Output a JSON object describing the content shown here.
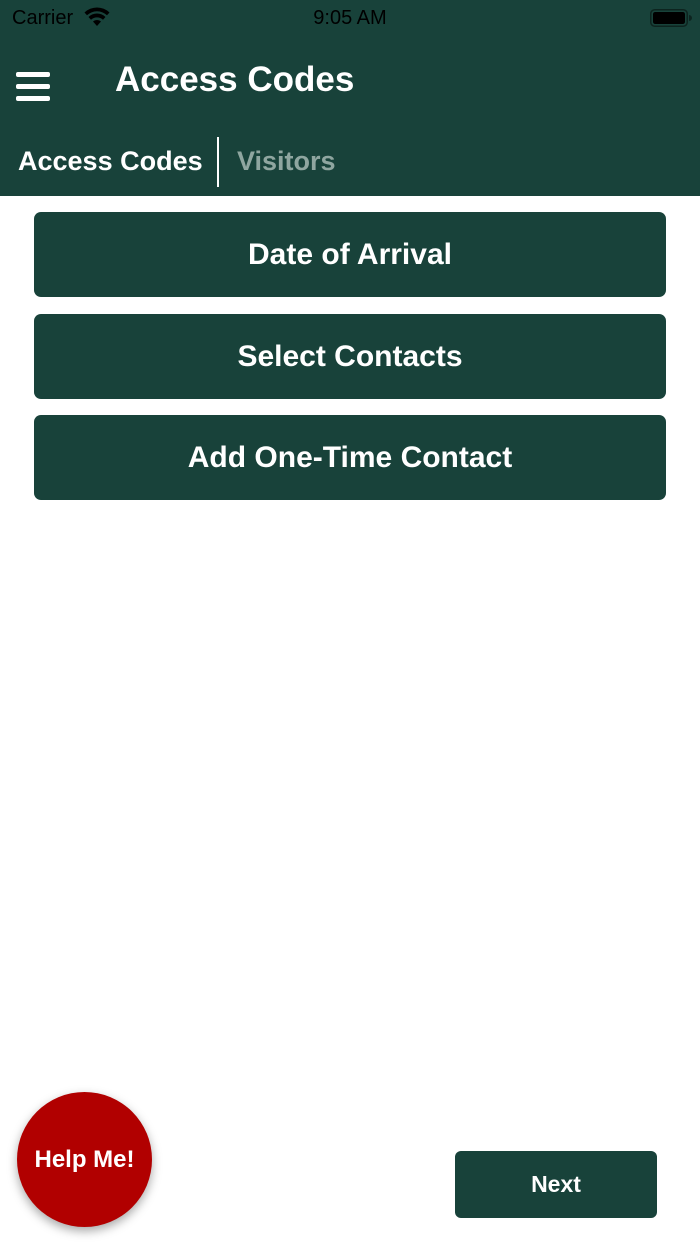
{
  "status_bar": {
    "carrier": "Carrier",
    "time": "9:05 AM",
    "wifi_icon": "wifi-icon",
    "battery_icon": "battery-icon"
  },
  "header": {
    "title": "Access Codes",
    "menu_icon": "hamburger-menu-icon",
    "background_color": "#18423a"
  },
  "tabs": [
    {
      "label": "Access Codes",
      "active": true
    },
    {
      "label": "Visitors",
      "active": false
    }
  ],
  "actions": [
    {
      "label": "Date of Arrival"
    },
    {
      "label": "Select Contacts"
    },
    {
      "label": "Add One-Time Contact"
    }
  ],
  "help_button": {
    "label": "Help Me!",
    "color": "#b10000"
  },
  "next_button": {
    "label": "Next"
  },
  "colors": {
    "primary": "#18423a",
    "tab_inactive": "#8fa6a0",
    "help": "#b10000"
  }
}
